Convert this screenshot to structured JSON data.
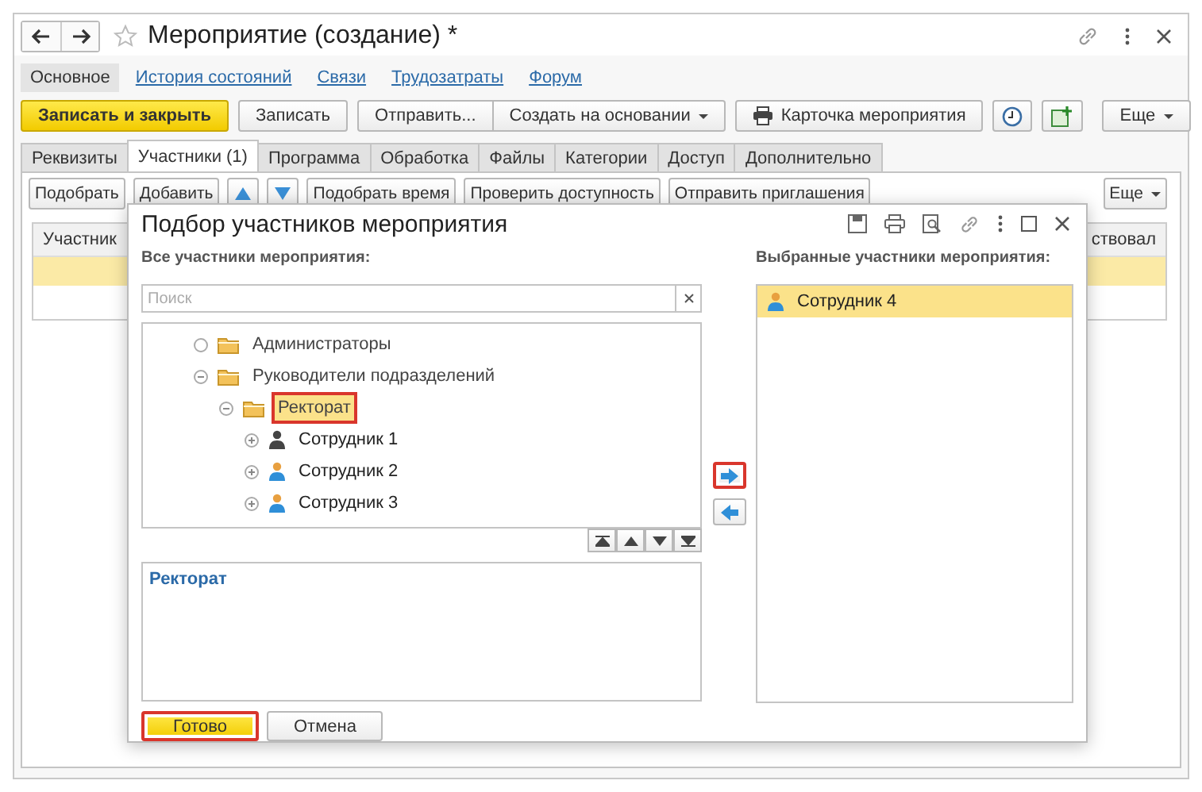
{
  "window": {
    "title": "Мероприятие (создание) *"
  },
  "nav": [
    {
      "label": "Основное",
      "selected": true
    },
    {
      "label": "История состояний",
      "selected": false
    },
    {
      "label": "Связи",
      "selected": false
    },
    {
      "label": "Трудозатраты",
      "selected": false
    },
    {
      "label": "Форум",
      "selected": false
    }
  ],
  "command_groups": [
    [
      {
        "label": "Записать и закрыть",
        "kind": "primary"
      }
    ],
    [
      {
        "label": "Записать",
        "kind": "plain"
      }
    ],
    [
      {
        "label": "Отправить...",
        "kind": "plain"
      },
      {
        "label": "Создать на основании",
        "kind": "menu"
      }
    ],
    [
      {
        "label": "Карточка мероприятия",
        "kind": "print"
      }
    ]
  ],
  "more_button": "Еще",
  "tabs": [
    {
      "label": "Реквизиты",
      "selected": false
    },
    {
      "label": "Участники (1)",
      "selected": true
    },
    {
      "label": "Программа",
      "selected": false
    },
    {
      "label": "Обработка",
      "selected": false
    },
    {
      "label": "Файлы",
      "selected": false
    },
    {
      "label": "Категории",
      "selected": false
    },
    {
      "label": "Доступ",
      "selected": false
    },
    {
      "label": "Дополнительно",
      "selected": false
    }
  ],
  "panel_toolbar": [
    {
      "label": "Подобрать",
      "kind": "text"
    },
    {
      "label": "Добавить",
      "kind": "text"
    },
    {
      "kind": "up"
    },
    {
      "kind": "down"
    },
    {
      "label": "Подобрать время",
      "kind": "text"
    },
    {
      "label": "Проверить доступность",
      "kind": "text"
    },
    {
      "label": "Отправить приглашения",
      "kind": "text"
    }
  ],
  "panel_more": "Еще",
  "table": {
    "columns": [
      "Участник",
      "ствовал"
    ],
    "rows": [
      {
        "selected": true
      }
    ]
  },
  "dialog": {
    "title": "Подбор участников мероприятия",
    "left_label": "Все участники мероприятия:",
    "search": {
      "placeholder": "Поиск"
    },
    "tree": [
      {
        "label": "Администраторы",
        "kind": "folder",
        "selected": false,
        "highlighted": false
      },
      {
        "label": "Руководители подразделений",
        "kind": "folder",
        "expanded": true,
        "selected": false,
        "highlighted": false,
        "children": [
          {
            "label": "Ректорат",
            "kind": "folder",
            "expanded": true,
            "selected": true,
            "highlighted": true,
            "children": [
              {
                "label": "Сотрудник 1",
                "kind": "user",
                "expanded": false,
                "selected": false,
                "highlighted": false
              },
              {
                "label": "Сотрудник 2",
                "kind": "employee",
                "expanded": false,
                "selected": false,
                "highlighted": false
              },
              {
                "label": "Сотрудник 3",
                "kind": "employee",
                "expanded": false,
                "selected": false,
                "highlighted": false
              }
            ]
          }
        ]
      }
    ],
    "description": "Ректорат",
    "move_buttons": [
      {
        "kind": "add",
        "highlighted": true
      },
      {
        "kind": "remove",
        "highlighted": false
      }
    ],
    "right_label": "Выбранные участники мероприятия:",
    "chosen": [
      {
        "label": "Сотрудник 4",
        "kind": "employee",
        "selected": true
      }
    ],
    "buttons": [
      {
        "label": "Готово",
        "kind": "primary",
        "highlighted": true
      },
      {
        "label": "Отмена",
        "kind": "plain",
        "highlighted": false
      }
    ]
  }
}
